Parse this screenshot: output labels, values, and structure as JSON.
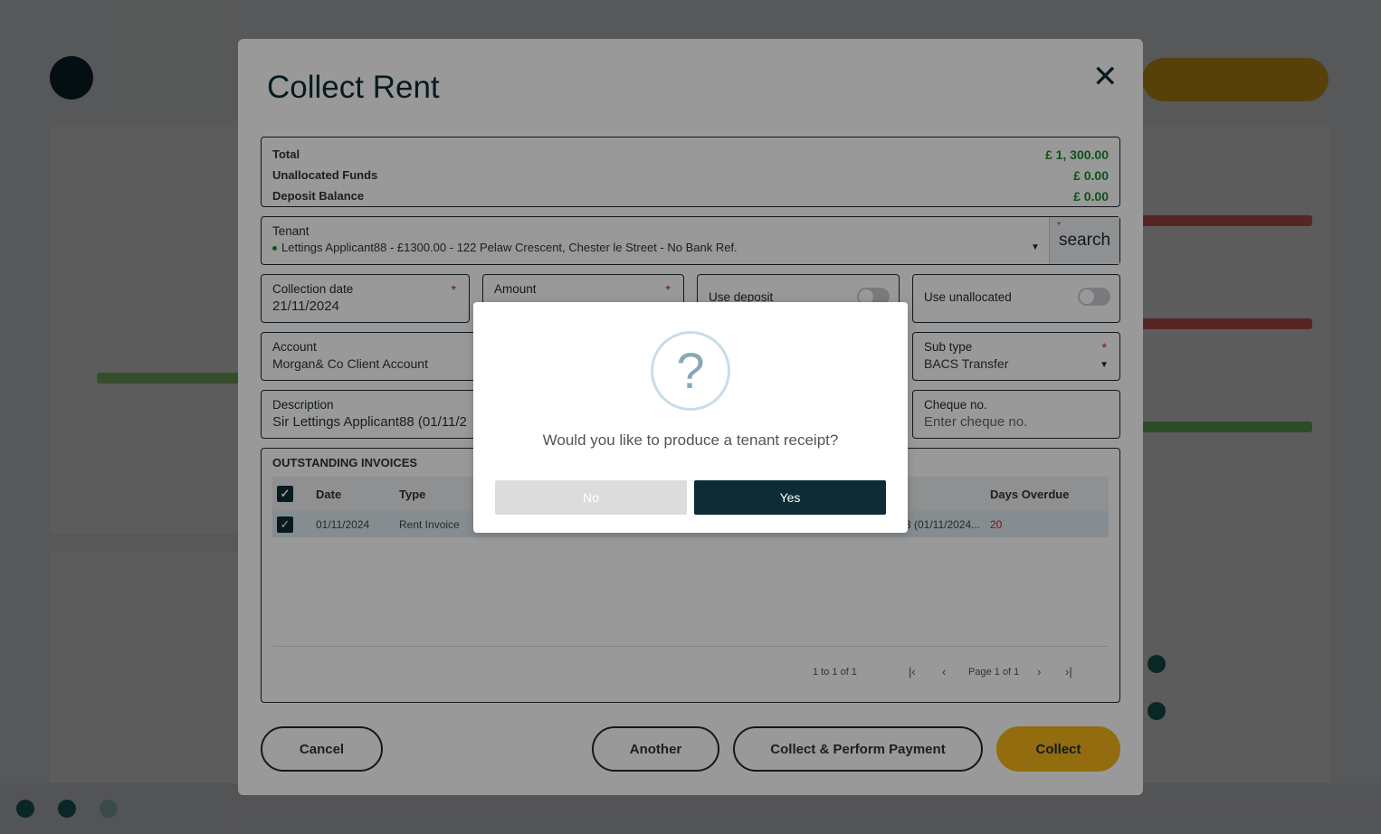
{
  "modal": {
    "title": "Collect Rent",
    "close_icon": "close-icon"
  },
  "totals": {
    "total_label": "Total",
    "total_value": "£ 1, 300.00",
    "unallocated_label": "Unallocated Funds",
    "unallocated_value": "£ 0.00",
    "deposit_label": "Deposit Balance",
    "deposit_value": "£ 0.00"
  },
  "tenant": {
    "label": "Tenant",
    "value": "Lettings Applicant88 - £1300.00 - 122 Pelaw Crescent, Chester le Street - No Bank Ref.",
    "search_label": "search"
  },
  "collection_date": {
    "label": "Collection date",
    "value": "21/11/2024"
  },
  "amount": {
    "label": "Amount"
  },
  "use_deposit": {
    "label": "Use deposit"
  },
  "use_unallocated": {
    "label": "Use unallocated"
  },
  "account": {
    "label": "Account",
    "value": "Morgan& Co Client Account"
  },
  "sub_type": {
    "label": "Sub type",
    "value": "BACS Transfer"
  },
  "description": {
    "label": "Description",
    "value": "Sir Lettings Applicant88 (01/11/2"
  },
  "cheque": {
    "label": "Cheque no.",
    "placeholder": "Enter cheque no."
  },
  "invoices": {
    "title": "OUTSTANDING INVOICES",
    "columns": {
      "date": "Date",
      "type": "Type",
      "days_overdue": "Days Overdue"
    },
    "rows": [
      {
        "date": "01/11/2024",
        "type": "Rent Invoice",
        "description": "8 (01/11/2024...",
        "days_overdue": "20"
      }
    ],
    "pagination": {
      "range": "1 to 1 of 1",
      "page": "Page 1 of 1"
    }
  },
  "footer": {
    "cancel": "Cancel",
    "another": "Another",
    "collect_perform": "Collect & Perform Payment",
    "collect": "Collect"
  },
  "dialog": {
    "icon_glyph": "?",
    "message": "Would you like to produce a tenant receipt?",
    "no": "No",
    "yes": "Yes"
  },
  "colors": {
    "brand_dark": "#0d2c36",
    "accent": "#f3b51a",
    "positive": "#1a8a2e",
    "danger": "#d21d1d"
  }
}
